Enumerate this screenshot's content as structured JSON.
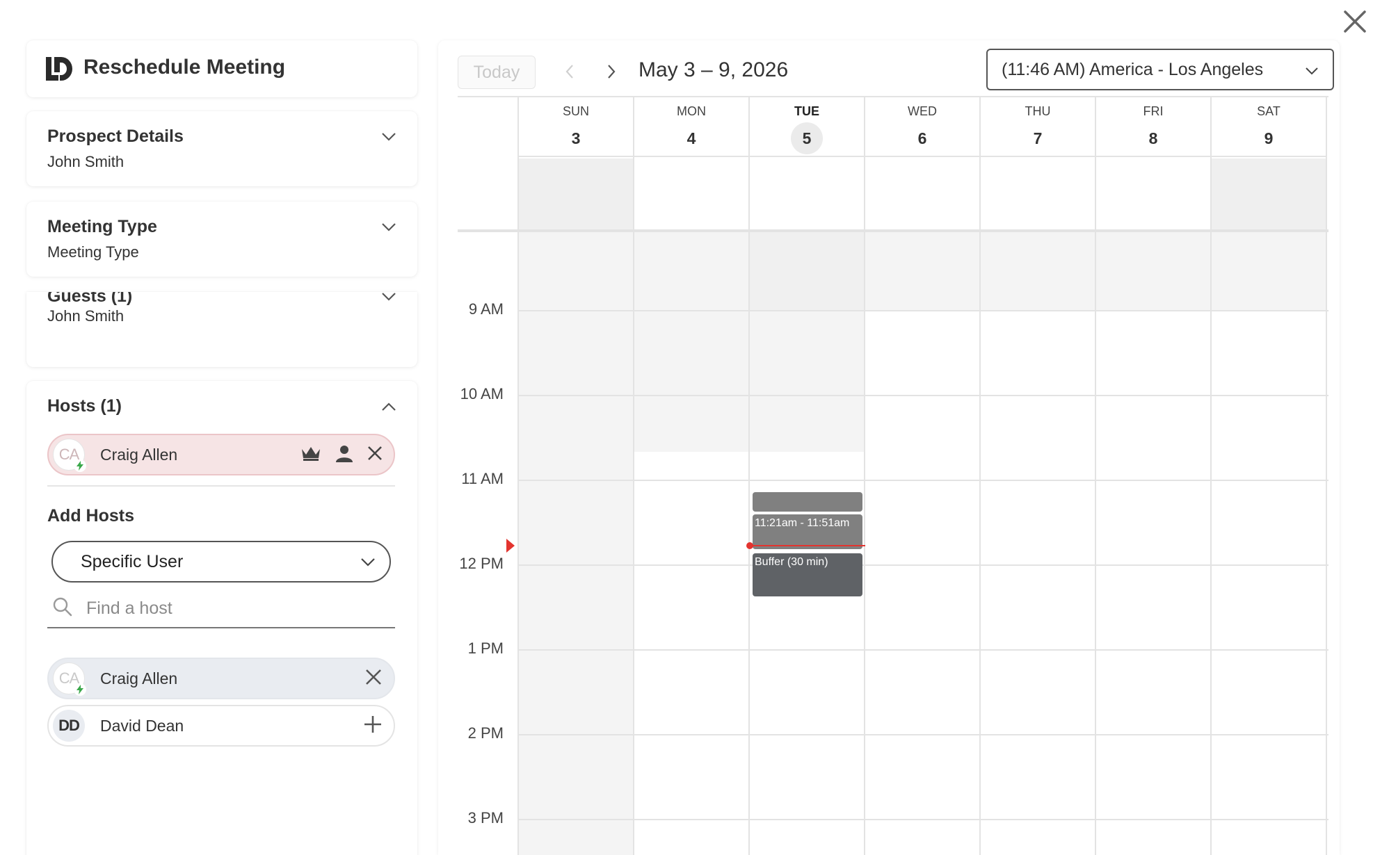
{
  "header": {
    "title": "Reschedule Meeting",
    "logo": "LD"
  },
  "left": {
    "prospect": {
      "title": "Prospect Details",
      "value": "John Smith"
    },
    "meeting_type": {
      "title": "Meeting Type",
      "value": "Meeting Type"
    },
    "guests": {
      "title": "Guests (1)",
      "value": "John Smith"
    },
    "hosts": {
      "title": "Hosts (1)",
      "selected": [
        {
          "initials": "CA",
          "name": "Craig Allen"
        }
      ],
      "add_hosts_label": "Add Hosts",
      "mode_select": "Specific User",
      "search_placeholder": "Find a host",
      "list": [
        {
          "initials": "CA",
          "name": "Craig Allen",
          "action": "remove"
        },
        {
          "initials": "DD",
          "name": "David Dean",
          "action": "add"
        }
      ]
    }
  },
  "calendar": {
    "today_label": "Today",
    "range_label": "May 3 – 9, 2026",
    "timezone": "(11:46 AM) America - Los Angeles",
    "days": [
      {
        "dow": "SUN",
        "num": "3"
      },
      {
        "dow": "MON",
        "num": "4"
      },
      {
        "dow": "TUE",
        "num": "5",
        "today": true
      },
      {
        "dow": "WED",
        "num": "6"
      },
      {
        "dow": "THU",
        "num": "7"
      },
      {
        "dow": "FRI",
        "num": "8"
      },
      {
        "dow": "SAT",
        "num": "9"
      }
    ],
    "hours": [
      "9 AM",
      "10 AM",
      "11 AM",
      "12 PM",
      "1 PM",
      "2 PM",
      "3 PM"
    ],
    "events": [
      {
        "label": "11:21am - 11:51am",
        "day": "TUE"
      },
      {
        "label": "Buffer (30 min)",
        "day": "TUE"
      }
    ],
    "colors": {
      "now": "#e3342f",
      "event": "#808080",
      "event_dark": "#5f6266",
      "weekend_shade": "#f2f2f2"
    }
  }
}
